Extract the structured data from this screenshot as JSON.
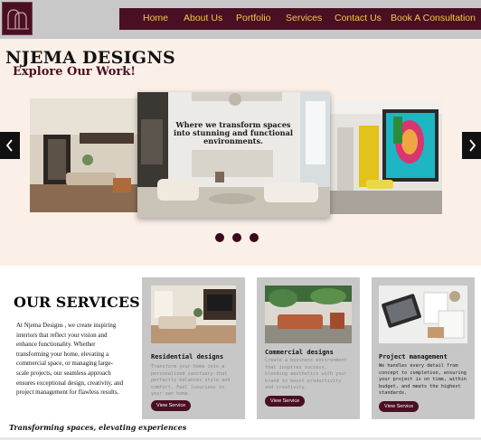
{
  "header": {
    "nav": [
      {
        "label": "Home"
      },
      {
        "label": "About Us"
      },
      {
        "label": "Portfolio"
      },
      {
        "label": "Services"
      },
      {
        "label": "Contact Us"
      },
      {
        "label": "Book A Consultation"
      }
    ]
  },
  "hero": {
    "brand": "NJEMA DESIGNS",
    "subtitle": "Explore Our Work!",
    "slide_caption": "Where we transform spaces into stunning and functional environments."
  },
  "services": {
    "title": "OUR SERVICES",
    "intro": "At Njema Designs , we create inspiring interiors that reflect your vision and enhance functionality. Whether transforming your home, elevating a commercial space, or managing large-scale projects, our seamless approach ensures exceptional design, creativity, and project management for flawless results.",
    "cards": [
      {
        "title": "Residential designs",
        "desc": "Transform your home into a personalized sanctuary that perfectly balances style and comfort. Feel luxurious in your own home.",
        "button": "View Service",
        "desc_color": "#8a8a8a"
      },
      {
        "title": "Commercial designs",
        "desc": "Create a business environment that inspires success, blending aesthetics with your brand to boost productivity and creativity.",
        "button": "View Service",
        "desc_color": "#8a8a8a"
      },
      {
        "title": "Project management",
        "desc": "We handles every detail from concept to completion, ensuring your project is on time, within budget, and meets the highest standards.",
        "button": "View Service",
        "desc_color": "#222222"
      }
    ],
    "tagline": "Transforming spaces, elevating experiences"
  },
  "colors": {
    "brand": "#4a0f22",
    "nav_text": "#f2c84b",
    "hero_bg": "#fbf0e8",
    "card_bg": "#c7c7c7"
  },
  "icons": {
    "prev": "chevron-left-icon",
    "next": "chevron-right-icon"
  }
}
